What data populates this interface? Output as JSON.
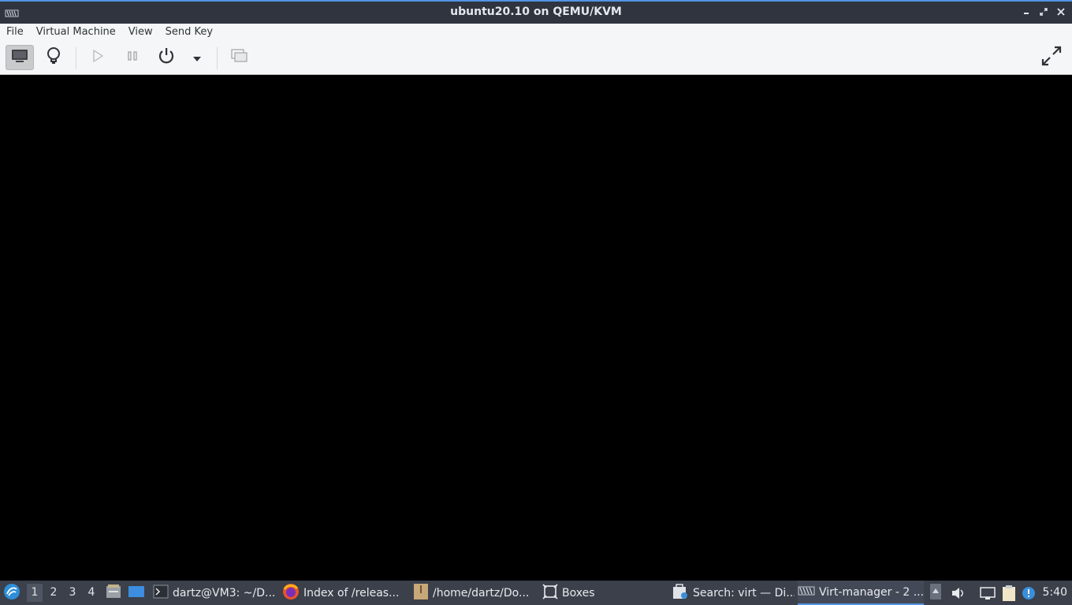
{
  "window": {
    "title": "ubuntu20.10 on QEMU/KVM",
    "icon": "virt-manager-icon",
    "controls": [
      "minimize-icon",
      "maximize-icon",
      "close-icon"
    ]
  },
  "menubar": {
    "items": [
      "File",
      "Virtual Machine",
      "View",
      "Send Key"
    ]
  },
  "toolbar": {
    "buttons": [
      {
        "name": "console-view-button",
        "icon": "monitor-icon",
        "active": true
      },
      {
        "name": "details-view-button",
        "icon": "lightbulb-icon",
        "active": false
      },
      {
        "name": "run-button",
        "icon": "play-icon",
        "enabled": false
      },
      {
        "name": "pause-button",
        "icon": "pause-icon",
        "enabled": false
      },
      {
        "name": "shutdown-button",
        "icon": "power-icon",
        "enabled": true
      },
      {
        "name": "shutdown-menu-button",
        "icon": "dropdown-arrow-icon",
        "enabled": true
      },
      {
        "name": "snapshots-button",
        "icon": "snapshots-icon",
        "enabled": false
      },
      {
        "name": "fullscreen-button",
        "icon": "fullscreen-icon",
        "enabled": true
      }
    ]
  },
  "console": {
    "background": "#000000"
  },
  "taskbar": {
    "workspaces": [
      "1",
      "2",
      "3",
      "4"
    ],
    "active_workspace": "1",
    "tasks": [
      {
        "label": "dartz@VM3: ~/D...",
        "icon": "terminal-icon"
      },
      {
        "label": "Index of /releas...",
        "icon": "firefox-icon"
      },
      {
        "label": "/home/dartz/Do...",
        "icon": "archive-icon"
      },
      {
        "label": "Boxes",
        "icon": "boxes-icon"
      },
      {
        "label": "Search: virt — Di...",
        "icon": "software-center-icon"
      },
      {
        "label": "Virt-manager - 2 ...",
        "icon": "virt-manager-icon",
        "active": true
      }
    ],
    "clock": "5:40"
  },
  "colors": {
    "titlebar": "#2f343f",
    "accent": "#5294e2",
    "toolbar": "#f5f6f7",
    "taskbar": "#3b404b"
  }
}
